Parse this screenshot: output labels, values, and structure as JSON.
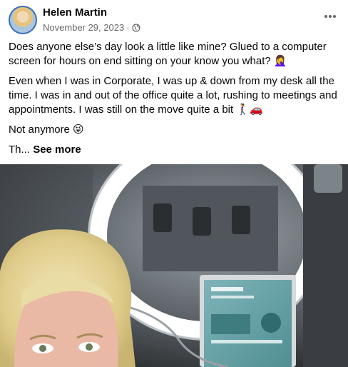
{
  "post": {
    "author": "Helen Martin",
    "date": "November 29, 2023",
    "separator": "·",
    "privacy_icon": "globe-icon",
    "paragraphs": [
      "Does anyone else’s day look a little like mine? Glued to a computer screen for hours on end sitting on your know you what? 🤦‍♀️",
      "Even when I was in Corporate, I was up & down from my desk all the time. I was in and out of the office quite a lot, rushing to meetings and appointments. I was still on the move quite a bit 🚶‍♀️🚗",
      "Not anymore 😜"
    ],
    "truncated_text": "Th...",
    "see_more_label": "See more"
  },
  "menu": {
    "more_icon": "more-options-icon"
  },
  "colors": {
    "meta_text": "#65676b",
    "text": "#050505",
    "avatar_ring": "#3b6fb6"
  }
}
